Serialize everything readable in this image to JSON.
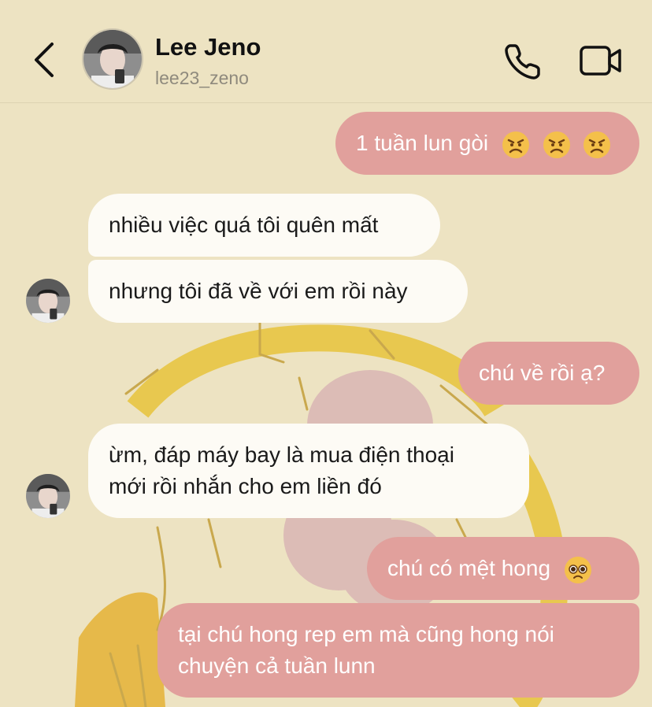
{
  "header": {
    "name": "Lee Jeno",
    "username": "lee23_zeno"
  },
  "icons": {
    "back": "chevron-left-icon",
    "call": "phone-icon",
    "video": "video-camera-icon"
  },
  "colors": {
    "background": "#ede3c2",
    "outgoing_bubble": "#e1a09c",
    "incoming_bubble": "#fdfbf5",
    "art_yellow": "#e8c84f",
    "art_pink": "#dcbcb6"
  },
  "messages": [
    {
      "direction": "outgoing",
      "text": "1 tuần lun gòi",
      "emoji": [
        "angry-face",
        "angry-face",
        "angry-face"
      ]
    },
    {
      "direction": "incoming",
      "text": "nhiều việc quá tôi quên mất"
    },
    {
      "direction": "incoming",
      "text": "nhưng tôi đã về với em rồi này"
    },
    {
      "direction": "outgoing",
      "text": "chú về rồi ạ?"
    },
    {
      "direction": "incoming",
      "line1": "ừm, đáp máy bay là mua điện thoại",
      "line2": "mới rồi nhắn cho em liền đó"
    },
    {
      "direction": "outgoing",
      "text": "chú có mệt hong",
      "emoji": [
        "pleading-face"
      ]
    },
    {
      "direction": "outgoing",
      "line1": "tại chú hong rep em mà cũng hong nói",
      "line2": "chuyện cả tuần lunn"
    }
  ]
}
